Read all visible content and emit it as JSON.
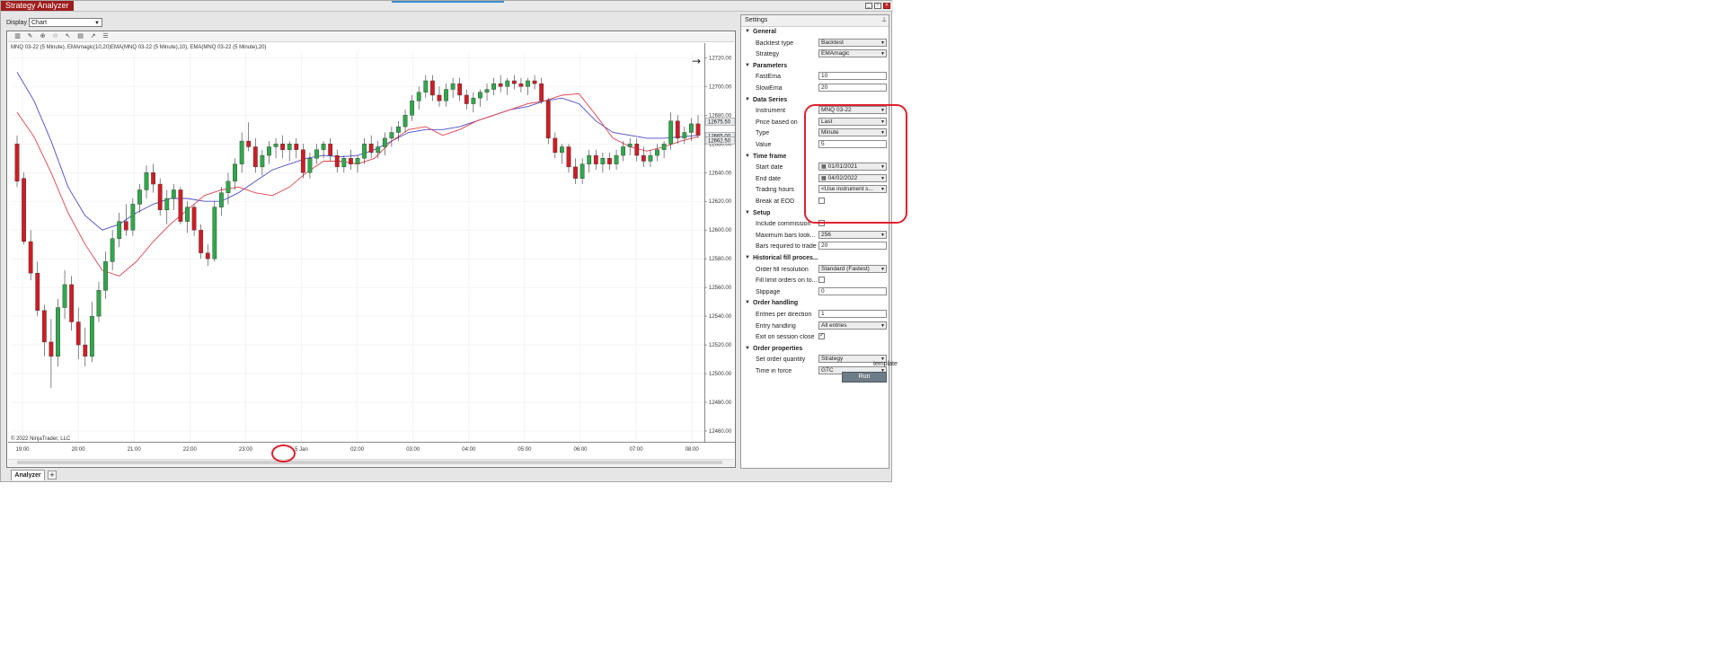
{
  "window": {
    "title": "Strategy Analyzer",
    "controls": [
      "minimize-icon",
      "restore-icon",
      "close-icon"
    ]
  },
  "display": {
    "label": "Display",
    "value": "Chart"
  },
  "chart": {
    "legend": "MNQ 03-22 (5 Minute), EMAmagic(10,20)EMA(MNQ 03-22 (5 Minute),10), EMA(MNQ 03-22 (5 Minute),20)",
    "copyright": "© 2022 NinjaTrader, LLC",
    "nav_arrow": "→",
    "toolbar_icons": [
      "bar-style-icon",
      "draw-icon",
      "zoom-in-icon",
      "zoom-out-icon",
      "cursor-icon",
      "properties-icon",
      "indicator-icon",
      "list-icon"
    ]
  },
  "chart_data": {
    "type": "candlestick",
    "instrument": "MNQ 03-22 (5 Minute)",
    "y_ticks": [
      "12460.00",
      "12480.00",
      "12500.00",
      "12520.00",
      "12540.00",
      "12560.00",
      "12580.00",
      "12600.00",
      "12620.00",
      "12640.00",
      "12660.00",
      "12680.00",
      "12700.00",
      "12720.00"
    ],
    "ylim": [
      12460,
      12724
    ],
    "x_ticks": [
      "19:00",
      "20:00",
      "21:00",
      "22:00",
      "23:00",
      "5 Jan",
      "02:00",
      "03:00",
      "04:00",
      "05:00",
      "06:00",
      "07:00",
      "08:00"
    ],
    "price_tags": [
      {
        "value": "12675.50",
        "y": 12675.5,
        "color": "#9aa3ad"
      },
      {
        "value": "12665.00",
        "y": 12665.5,
        "color": "#9aa3ad"
      },
      {
        "value": "12662.50",
        "y": 12662.5,
        "color": "#9aa3ad"
      }
    ],
    "series": [
      {
        "name": "EMA(MNQ 03-22 (5 Minute),10)",
        "color": "#e0404a"
      },
      {
        "name": "EMA(MNQ 03-22 (5 Minute),20)",
        "color": "#4a4ac8"
      }
    ],
    "ema_fast": [
      12682,
      12665,
      12640,
      12612,
      12590,
      12572,
      12568,
      12578,
      12592,
      12604,
      12614,
      12624,
      12628,
      12630,
      12626,
      12624,
      12630,
      12640,
      12648,
      12648,
      12646,
      12650,
      12662,
      12670,
      12672,
      12666,
      12670,
      12676,
      12680,
      12684,
      12688,
      12690,
      12694,
      12695,
      12680,
      12664,
      12658,
      12655,
      12658,
      12662,
      12665
    ],
    "ema_slow": [
      12710,
      12690,
      12662,
      12630,
      12610,
      12600,
      12604,
      12612,
      12618,
      12622,
      12622,
      12620,
      12620,
      12626,
      12634,
      12642,
      12646,
      12650,
      12652,
      12651,
      12652,
      12656,
      12662,
      12668,
      12670,
      12670,
      12672,
      12676,
      12680,
      12684,
      12686,
      12690,
      12692,
      12688,
      12676,
      12668,
      12666,
      12664,
      12664,
      12665,
      12666
    ],
    "candles": [
      {
        "o": 12660,
        "h": 12666,
        "l": 12630,
        "c": 12634
      },
      {
        "o": 12636,
        "h": 12640,
        "l": 12590,
        "c": 12592
      },
      {
        "o": 12592,
        "h": 12600,
        "l": 12565,
        "c": 12570
      },
      {
        "o": 12570,
        "h": 12578,
        "l": 12540,
        "c": 12544
      },
      {
        "o": 12544,
        "h": 12548,
        "l": 12512,
        "c": 12522
      },
      {
        "o": 12522,
        "h": 12538,
        "l": 12490,
        "c": 12512
      },
      {
        "o": 12512,
        "h": 12552,
        "l": 12505,
        "c": 12546
      },
      {
        "o": 12546,
        "h": 12572,
        "l": 12538,
        "c": 12562
      },
      {
        "o": 12562,
        "h": 12568,
        "l": 12530,
        "c": 12536
      },
      {
        "o": 12536,
        "h": 12546,
        "l": 12510,
        "c": 12520
      },
      {
        "o": 12520,
        "h": 12532,
        "l": 12505,
        "c": 12512
      },
      {
        "o": 12512,
        "h": 12550,
        "l": 12508,
        "c": 12540
      },
      {
        "o": 12540,
        "h": 12564,
        "l": 12536,
        "c": 12558
      },
      {
        "o": 12558,
        "h": 12585,
        "l": 12552,
        "c": 12578
      },
      {
        "o": 12578,
        "h": 12600,
        "l": 12572,
        "c": 12594
      },
      {
        "o": 12594,
        "h": 12612,
        "l": 12588,
        "c": 12606
      },
      {
        "o": 12606,
        "h": 12618,
        "l": 12596,
        "c": 12600
      },
      {
        "o": 12600,
        "h": 12622,
        "l": 12596,
        "c": 12618
      },
      {
        "o": 12618,
        "h": 12632,
        "l": 12612,
        "c": 12628
      },
      {
        "o": 12628,
        "h": 12645,
        "l": 12622,
        "c": 12640
      },
      {
        "o": 12640,
        "h": 12646,
        "l": 12626,
        "c": 12632
      },
      {
        "o": 12632,
        "h": 12636,
        "l": 12610,
        "c": 12614
      },
      {
        "o": 12614,
        "h": 12628,
        "l": 12604,
        "c": 12622
      },
      {
        "o": 12622,
        "h": 12632,
        "l": 12614,
        "c": 12628
      },
      {
        "o": 12628,
        "h": 12630,
        "l": 12604,
        "c": 12606
      },
      {
        "o": 12606,
        "h": 12620,
        "l": 12598,
        "c": 12616
      },
      {
        "o": 12616,
        "h": 12618,
        "l": 12596,
        "c": 12600
      },
      {
        "o": 12600,
        "h": 12604,
        "l": 12580,
        "c": 12584
      },
      {
        "o": 12584,
        "h": 12590,
        "l": 12575,
        "c": 12580
      },
      {
        "o": 12580,
        "h": 12620,
        "l": 12578,
        "c": 12616
      },
      {
        "o": 12616,
        "h": 12630,
        "l": 12610,
        "c": 12626
      },
      {
        "o": 12626,
        "h": 12640,
        "l": 12618,
        "c": 12634
      },
      {
        "o": 12634,
        "h": 12650,
        "l": 12628,
        "c": 12646
      },
      {
        "o": 12646,
        "h": 12668,
        "l": 12640,
        "c": 12662
      },
      {
        "o": 12662,
        "h": 12675,
        "l": 12655,
        "c": 12658
      },
      {
        "o": 12658,
        "h": 12664,
        "l": 12640,
        "c": 12644
      },
      {
        "o": 12644,
        "h": 12656,
        "l": 12638,
        "c": 12652
      },
      {
        "o": 12652,
        "h": 12662,
        "l": 12646,
        "c": 12658
      },
      {
        "o": 12658,
        "h": 12664,
        "l": 12650,
        "c": 12660
      },
      {
        "o": 12660,
        "h": 12666,
        "l": 12650,
        "c": 12656
      },
      {
        "o": 12656,
        "h": 12662,
        "l": 12648,
        "c": 12660
      },
      {
        "o": 12660,
        "h": 12664,
        "l": 12650,
        "c": 12656
      },
      {
        "o": 12656,
        "h": 12660,
        "l": 12636,
        "c": 12640
      },
      {
        "o": 12640,
        "h": 12654,
        "l": 12636,
        "c": 12650
      },
      {
        "o": 12650,
        "h": 12660,
        "l": 12646,
        "c": 12656
      },
      {
        "o": 12656,
        "h": 12662,
        "l": 12650,
        "c": 12660
      },
      {
        "o": 12660,
        "h": 12664,
        "l": 12648,
        "c": 12652
      },
      {
        "o": 12652,
        "h": 12656,
        "l": 12640,
        "c": 12644
      },
      {
        "o": 12644,
        "h": 12652,
        "l": 12640,
        "c": 12650
      },
      {
        "o": 12650,
        "h": 12656,
        "l": 12642,
        "c": 12646
      },
      {
        "o": 12646,
        "h": 12652,
        "l": 12640,
        "c": 12650
      },
      {
        "o": 12650,
        "h": 12664,
        "l": 12646,
        "c": 12660
      },
      {
        "o": 12660,
        "h": 12666,
        "l": 12650,
        "c": 12654
      },
      {
        "o": 12654,
        "h": 12662,
        "l": 12650,
        "c": 12658
      },
      {
        "o": 12658,
        "h": 12668,
        "l": 12652,
        "c": 12664
      },
      {
        "o": 12664,
        "h": 12672,
        "l": 12658,
        "c": 12668
      },
      {
        "o": 12668,
        "h": 12676,
        "l": 12662,
        "c": 12672
      },
      {
        "o": 12672,
        "h": 12684,
        "l": 12668,
        "c": 12680
      },
      {
        "o": 12680,
        "h": 12694,
        "l": 12676,
        "c": 12690
      },
      {
        "o": 12690,
        "h": 12700,
        "l": 12684,
        "c": 12696
      },
      {
        "o": 12696,
        "h": 12708,
        "l": 12692,
        "c": 12704
      },
      {
        "o": 12704,
        "h": 12708,
        "l": 12690,
        "c": 12694
      },
      {
        "o": 12694,
        "h": 12700,
        "l": 12686,
        "c": 12690
      },
      {
        "o": 12690,
        "h": 12702,
        "l": 12686,
        "c": 12698
      },
      {
        "o": 12698,
        "h": 12706,
        "l": 12692,
        "c": 12702
      },
      {
        "o": 12702,
        "h": 12706,
        "l": 12690,
        "c": 12694
      },
      {
        "o": 12694,
        "h": 12698,
        "l": 12684,
        "c": 12688
      },
      {
        "o": 12688,
        "h": 12696,
        "l": 12682,
        "c": 12692
      },
      {
        "o": 12692,
        "h": 12698,
        "l": 12686,
        "c": 12696
      },
      {
        "o": 12696,
        "h": 12702,
        "l": 12690,
        "c": 12698
      },
      {
        "o": 12698,
        "h": 12706,
        "l": 12694,
        "c": 12702
      },
      {
        "o": 12702,
        "h": 12708,
        "l": 12696,
        "c": 12700
      },
      {
        "o": 12700,
        "h": 12706,
        "l": 12694,
        "c": 12704
      },
      {
        "o": 12704,
        "h": 12708,
        "l": 12698,
        "c": 12702
      },
      {
        "o": 12702,
        "h": 12706,
        "l": 12696,
        "c": 12700
      },
      {
        "o": 12700,
        "h": 12706,
        "l": 12694,
        "c": 12704
      },
      {
        "o": 12704,
        "h": 12708,
        "l": 12698,
        "c": 12702
      },
      {
        "o": 12702,
        "h": 12706,
        "l": 12688,
        "c": 12690
      },
      {
        "o": 12690,
        "h": 12692,
        "l": 12660,
        "c": 12664
      },
      {
        "o": 12664,
        "h": 12668,
        "l": 12650,
        "c": 12654
      },
      {
        "o": 12654,
        "h": 12660,
        "l": 12646,
        "c": 12658
      },
      {
        "o": 12658,
        "h": 12660,
        "l": 12640,
        "c": 12644
      },
      {
        "o": 12644,
        "h": 12650,
        "l": 12632,
        "c": 12636
      },
      {
        "o": 12636,
        "h": 12650,
        "l": 12632,
        "c": 12646
      },
      {
        "o": 12646,
        "h": 12656,
        "l": 12640,
        "c": 12652
      },
      {
        "o": 12652,
        "h": 12656,
        "l": 12642,
        "c": 12646
      },
      {
        "o": 12646,
        "h": 12654,
        "l": 12640,
        "c": 12650
      },
      {
        "o": 12650,
        "h": 12654,
        "l": 12642,
        "c": 12646
      },
      {
        "o": 12646,
        "h": 12656,
        "l": 12642,
        "c": 12652
      },
      {
        "o": 12652,
        "h": 12662,
        "l": 12648,
        "c": 12658
      },
      {
        "o": 12658,
        "h": 12664,
        "l": 12652,
        "c": 12660
      },
      {
        "o": 12660,
        "h": 12664,
        "l": 12648,
        "c": 12652
      },
      {
        "o": 12652,
        "h": 12658,
        "l": 12644,
        "c": 12648
      },
      {
        "o": 12648,
        "h": 12656,
        "l": 12644,
        "c": 12652
      },
      {
        "o": 12652,
        "h": 12660,
        "l": 12648,
        "c": 12656
      },
      {
        "o": 12656,
        "h": 12662,
        "l": 12650,
        "c": 12660
      },
      {
        "o": 12660,
        "h": 12682,
        "l": 12656,
        "c": 12676
      },
      {
        "o": 12676,
        "h": 12680,
        "l": 12660,
        "c": 12664
      },
      {
        "o": 12664,
        "h": 12672,
        "l": 12660,
        "c": 12668
      },
      {
        "o": 12668,
        "h": 12678,
        "l": 12662,
        "c": 12674
      },
      {
        "o": 12674,
        "h": 12680,
        "l": 12664,
        "c": 12666
      }
    ]
  },
  "settings": {
    "title": "Settings",
    "sections": [
      {
        "label": "General",
        "rows": [
          {
            "label": "Backtest type",
            "value": "Backtest",
            "kind": "select"
          },
          {
            "label": "Strategy",
            "value": "EMAmagic",
            "kind": "select"
          }
        ]
      },
      {
        "label": "Parameters",
        "rows": [
          {
            "label": "FastEma",
            "value": "10",
            "kind": "text"
          },
          {
            "label": "SlowEma",
            "value": "20",
            "kind": "text"
          }
        ]
      },
      {
        "label": "Data Series",
        "rows": [
          {
            "label": "Instrument",
            "value": "MNQ 03-22",
            "kind": "select"
          },
          {
            "label": "Price based on",
            "value": "Last",
            "kind": "select"
          },
          {
            "label": "Type",
            "value": "Minute",
            "kind": "select"
          },
          {
            "label": "Value",
            "value": "5",
            "kind": "text"
          }
        ]
      },
      {
        "label": "Time frame",
        "rows": [
          {
            "label": "Start date",
            "value": "01/01/2021",
            "kind": "date"
          },
          {
            "label": "End date",
            "value": "04/02/2022",
            "kind": "date"
          },
          {
            "label": "Trading hours",
            "value": "<Use instrument s...",
            "kind": "select"
          },
          {
            "label": "Break at EOD",
            "value": "",
            "kind": "check",
            "checked": false
          }
        ]
      },
      {
        "label": "Setup",
        "rows": [
          {
            "label": "Include commission",
            "value": "",
            "kind": "check",
            "checked": false
          },
          {
            "label": "Maximum bars look...",
            "value": "256",
            "kind": "select"
          },
          {
            "label": "Bars required to trade",
            "value": "20",
            "kind": "text"
          }
        ]
      },
      {
        "label": "Historical fill proces...",
        "rows": [
          {
            "label": "Order fill resolution",
            "value": "Standard (Fastest)",
            "kind": "select"
          },
          {
            "label": "Fill limit orders on to...",
            "value": "",
            "kind": "check",
            "checked": false
          },
          {
            "label": "Slippage",
            "value": "0",
            "kind": "text"
          }
        ]
      },
      {
        "label": "Order handling",
        "rows": [
          {
            "label": "Entries per direction",
            "value": "1",
            "kind": "text"
          },
          {
            "label": "Entry handling",
            "value": "All entries",
            "kind": "select"
          },
          {
            "label": "Exit on session close",
            "value": "",
            "kind": "check",
            "checked": true
          }
        ]
      },
      {
        "label": "Order properties",
        "rows": [
          {
            "label": "Set order quantity",
            "value": "Strategy",
            "kind": "select"
          },
          {
            "label": "Time in force",
            "value": "GTC",
            "kind": "select"
          }
        ]
      }
    ],
    "template_label": "template",
    "run_label": "Run"
  },
  "tabs": {
    "analyzer": "Analyzer",
    "add": "+"
  },
  "colors": {
    "title_bg": "#9e1c1c",
    "bull": "#2fa84a",
    "bear": "#d01c24",
    "highlight": "#e0202e"
  }
}
